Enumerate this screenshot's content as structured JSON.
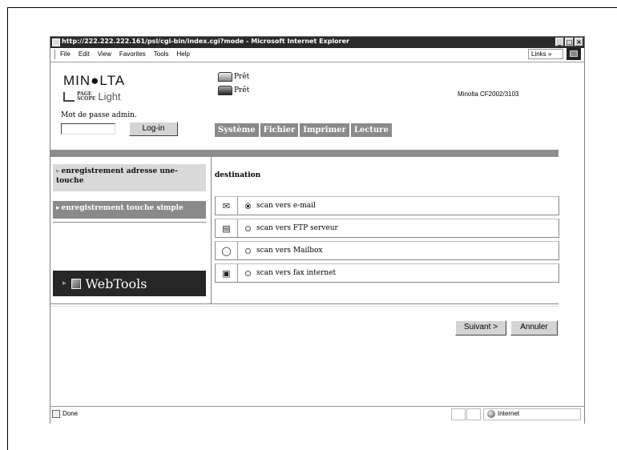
{
  "window": {
    "title": "http://222.222.222.161/psl/cgi-bin/index.cgi?mode - Microsoft Internet Explorer",
    "buttons": [
      "_",
      "□",
      "×"
    ]
  },
  "menu": {
    "items": [
      "File",
      "Edit",
      "View",
      "Favorites",
      "Tools",
      "Help"
    ],
    "links": "Links »"
  },
  "header": {
    "logo": "MIN●LTA",
    "pagescope_small_top": "PAGE",
    "pagescope_small_bottom": "SCOPE",
    "pagescope_light": "Light",
    "status_1": "Prêt",
    "status_2": "Prêt",
    "model": "Minolta CF2002/3103",
    "password_label": "Mot de passe admin.",
    "password_value": "",
    "login_label": "Log-in"
  },
  "tabs": [
    "Système",
    "Fichier",
    "Imprimer",
    "Lecture"
  ],
  "sidebar": {
    "items": [
      {
        "label": "enregistrement adresse une-touche"
      },
      {
        "label": "enregistrement touche simple"
      }
    ],
    "webtools": "WebTools"
  },
  "main": {
    "title": "destination",
    "options": [
      {
        "icon": "envelope-icon",
        "label": "scan vers e-mail",
        "selected": true
      },
      {
        "icon": "ftp-server-icon",
        "label": "scan vers FTP serveur",
        "selected": false
      },
      {
        "icon": "mailbox-icon",
        "label": "scan vers Mailbox",
        "selected": false
      },
      {
        "icon": "internet-fax-icon",
        "label": "scan vers fax internet",
        "selected": false
      }
    ],
    "next_label": "Suivant >",
    "cancel_label": "Annuler"
  },
  "statusbar": {
    "left": "Done",
    "zone": "Internet"
  }
}
